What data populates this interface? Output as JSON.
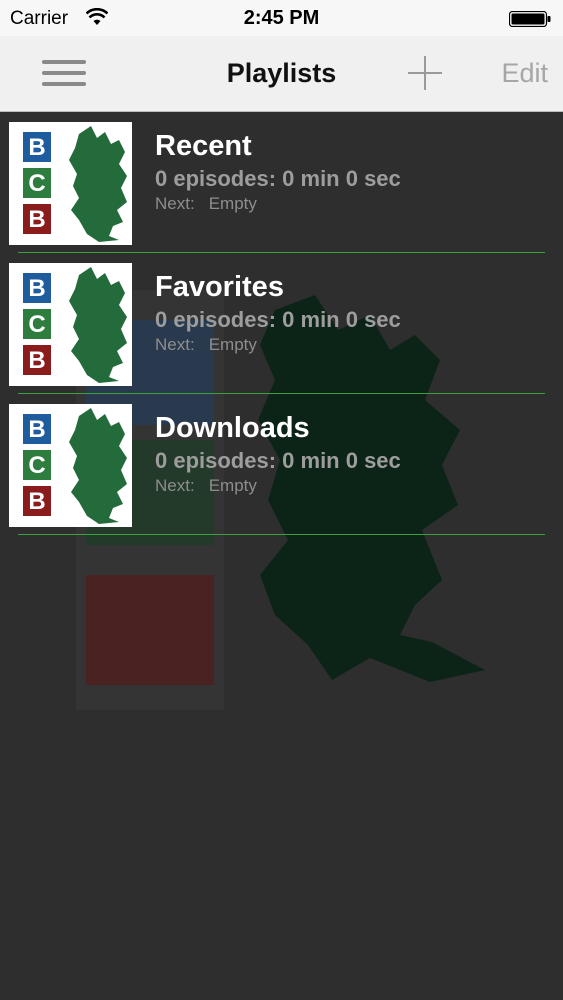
{
  "status_bar": {
    "carrier": "Carrier",
    "time": "2:45 PM"
  },
  "nav": {
    "title": "Playlists",
    "edit_label": "Edit"
  },
  "logo_letters": [
    "B",
    "C",
    "B"
  ],
  "colors": {
    "blue": "#1f5c9e",
    "green": "#2e7d3e",
    "red": "#8b1c1c",
    "map_green": "#236b3a",
    "separator": "#3ca03c"
  },
  "playlists": [
    {
      "title": "Recent",
      "summary": "0 episodes: 0 min 0 sec",
      "next_label": "Next:",
      "next_value": "Empty"
    },
    {
      "title": "Favorites",
      "summary": "0 episodes: 0 min 0 sec",
      "next_label": "Next:",
      "next_value": "Empty"
    },
    {
      "title": "Downloads",
      "summary": "0 episodes: 0 min 0 sec",
      "next_label": "Next:",
      "next_value": "Empty"
    }
  ]
}
